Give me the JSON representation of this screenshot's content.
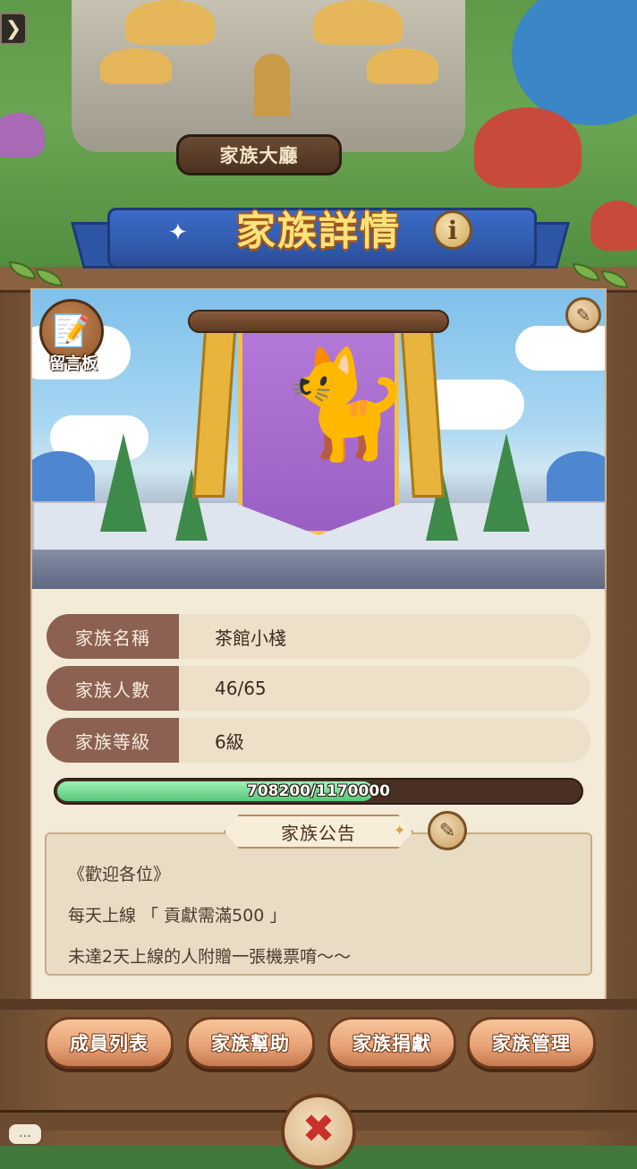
{
  "scene": {
    "hall_label": "家族大廳"
  },
  "header": {
    "title": "家族詳情",
    "info_glyph": "i"
  },
  "board": {
    "label": "留言板"
  },
  "info_rows": [
    {
      "label": "家族名稱",
      "value": "茶館小棧"
    },
    {
      "label": "家族人數",
      "value": "46/65"
    },
    {
      "label": "家族等級",
      "value": "6級"
    }
  ],
  "experience": {
    "text": "708200/1170000",
    "current": 708200,
    "max": 1170000
  },
  "notice": {
    "title": "家族公告",
    "lines": [
      "《歡迎各位》",
      "每天上線 「 貢獻需滿500 」",
      "未達2天上線的人附贈一張機票唷～～"
    ]
  },
  "buttons": {
    "members": "成員列表",
    "help": "家族幫助",
    "donate": "家族捐獻",
    "manage": "家族管理"
  },
  "colors": {
    "label_bg": "#8c6151",
    "button": "#e9a478",
    "title": "#fbe27a",
    "xp_fill": "#57c77a"
  },
  "icons": {
    "back": "chevron-right-icon",
    "info": "info-icon",
    "board": "notepad-icon",
    "edit": "feather-quill-icon",
    "close": "close-x-icon",
    "emblem": "cat-emblem-icon"
  }
}
